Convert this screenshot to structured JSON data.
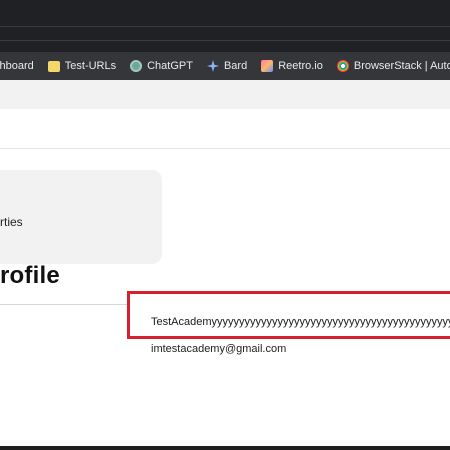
{
  "browser": {
    "bookmarks": [
      {
        "label": "shboard"
      },
      {
        "label": "Test-URLs",
        "icon": "folder-icon"
      },
      {
        "label": "ChatGPT",
        "icon": "chatgpt-icon"
      },
      {
        "label": "Bard",
        "icon": "bard-sparkle-icon"
      },
      {
        "label": "Reetro.io",
        "icon": "reetro-icon"
      },
      {
        "label": "BrowserStack | Auto...",
        "icon": "browserstack-icon"
      }
    ]
  },
  "sidebar": {
    "card_text": "rties"
  },
  "main": {
    "title": "rofile",
    "username": "TestAcademyyyyyyyyyyyyyyyyyyyyyyyyyyyyyyyyyyyyyyyyyyyyyyyy",
    "email": "imtestacademy@gmail.com"
  },
  "colors": {
    "highlight": "#d6202d",
    "chrome_dark": "#202124",
    "bookmark_bar": "#35363a"
  }
}
